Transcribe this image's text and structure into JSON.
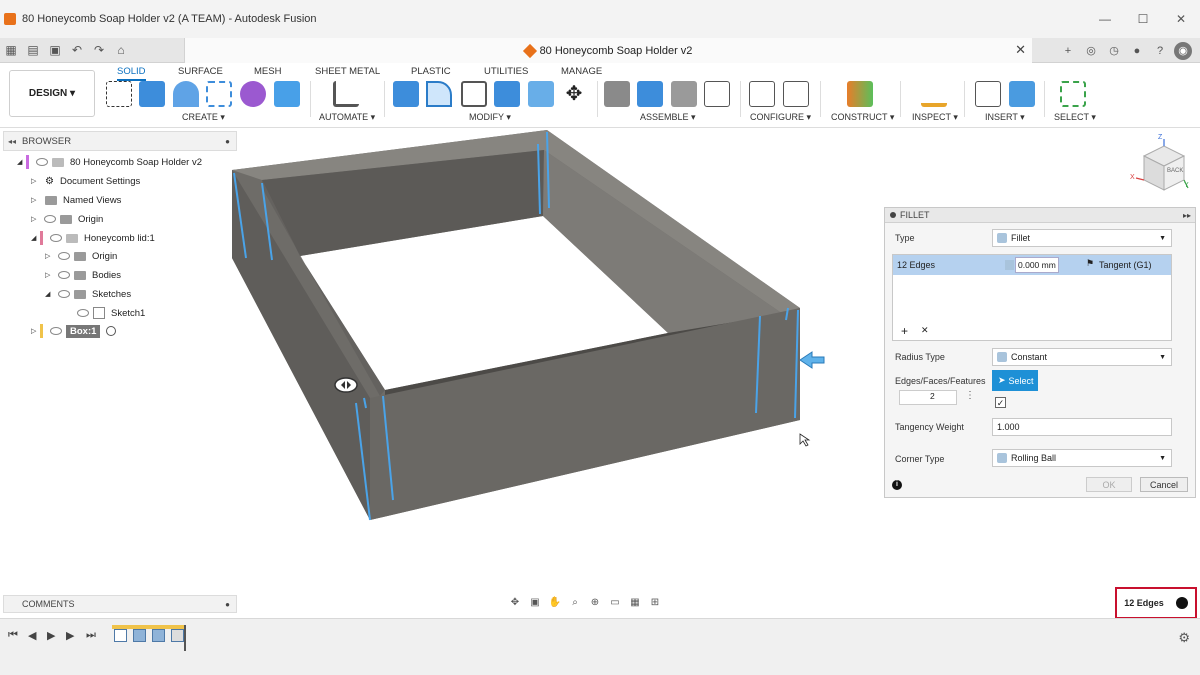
{
  "window": {
    "title": "80 Honeycomb Soap Holder v2 (A TEAM) - Autodesk Fusion",
    "minimize": "—",
    "maximize": "☐",
    "close": "✕"
  },
  "document_tab": {
    "title": "80 Honeycomb Soap Holder v2",
    "close": "✕"
  },
  "workspace": {
    "label": "DESIGN ▾"
  },
  "ribbon": {
    "tabs": [
      "SOLID",
      "SURFACE",
      "MESH",
      "SHEET METAL",
      "PLASTIC",
      "UTILITIES",
      "MANAGE"
    ],
    "groups": [
      "CREATE ▾",
      "AUTOMATE ▾",
      "MODIFY ▾",
      "ASSEMBLE ▾",
      "CONFIGURE ▾",
      "CONSTRUCT ▾",
      "INSPECT ▾",
      "INSERT ▾",
      "SELECT ▾"
    ]
  },
  "browser": {
    "title": "BROWSER",
    "items": [
      {
        "label": "80 Honeycomb Soap Holder v2"
      },
      {
        "label": "Document Settings"
      },
      {
        "label": "Named Views"
      },
      {
        "label": "Origin"
      },
      {
        "label": "Honeycomb lid:1"
      },
      {
        "label": "Origin"
      },
      {
        "label": "Bodies"
      },
      {
        "label": "Sketches"
      },
      {
        "label": "Sketch1"
      },
      {
        "label": "Box:1"
      }
    ]
  },
  "viewcube": {
    "face": "BACK",
    "axis_z": "Z",
    "axis_x": "X",
    "axis_y": "Y"
  },
  "fillet_dialog": {
    "title": "FILLET",
    "type_label": "Type",
    "type_value": "Fillet",
    "edges_label": "12 Edges",
    "radius_value": "0.000 mm",
    "continuity": "Tangent (G1)",
    "add": "+",
    "remove": "✕",
    "radius_type_label": "Radius Type",
    "radius_type_value": "Constant",
    "selection_label": "Edges/Faces/Features",
    "select_button": "Select",
    "inline_value": "2",
    "tangency_weight_label": "Tangency Weight",
    "tangency_weight_value": "1.000",
    "corner_type_label": "Corner Type",
    "corner_type_value": "Rolling Ball",
    "ok": "OK",
    "cancel": "Cancel"
  },
  "comments": {
    "title": "COMMENTS"
  },
  "selection_badge": {
    "label": "12 Edges"
  }
}
